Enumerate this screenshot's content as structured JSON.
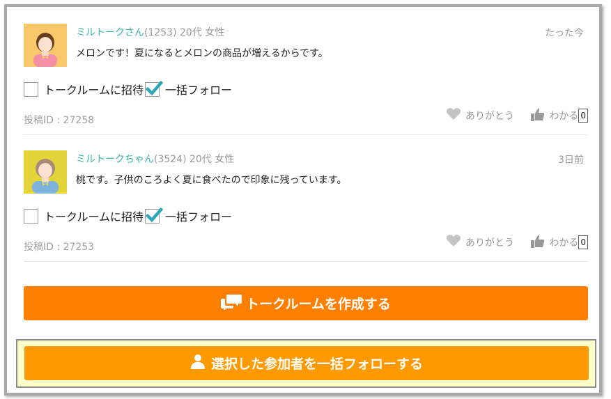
{
  "posts": [
    {
      "username": "ミルトークさん",
      "meta": "(1253) 20代 女性",
      "time": "たった今",
      "message": "メロンです！夏になるとメロンの商品が増えるからです。",
      "invite_label": "トークルームに招待",
      "follow_label": "一括フォロー",
      "post_id": "投稿ID : 27258",
      "thanks_label": "ありがとう",
      "agree_label": "わかる",
      "agree_count": "0",
      "avatar": "woman-avatar",
      "follow_checked": true,
      "invite_checked": false
    },
    {
      "username": "ミルトークちゃん",
      "meta": "(3524) 20代 女性",
      "time": "3日前",
      "message": "桃です。子供のころよく夏に食べたので印象に残っています。",
      "invite_label": "トークルームに招待",
      "follow_label": "一括フォロー",
      "post_id": "投稿ID : 27253",
      "thanks_label": "ありがとう",
      "agree_label": "わかる",
      "agree_count": "0",
      "avatar": "girl-avatar",
      "follow_checked": true,
      "invite_checked": false
    }
  ],
  "buttons": {
    "create_room": "トークルームを作成する",
    "bulk_follow": "選択した参加者を一括フォローする"
  },
  "colors": {
    "accent_orange": "#ff8000",
    "follow_orange": "#ff9900",
    "highlight_bg": "#ffffcc",
    "username_teal": "#3bb3a6",
    "check_teal": "#2fa6b7"
  }
}
